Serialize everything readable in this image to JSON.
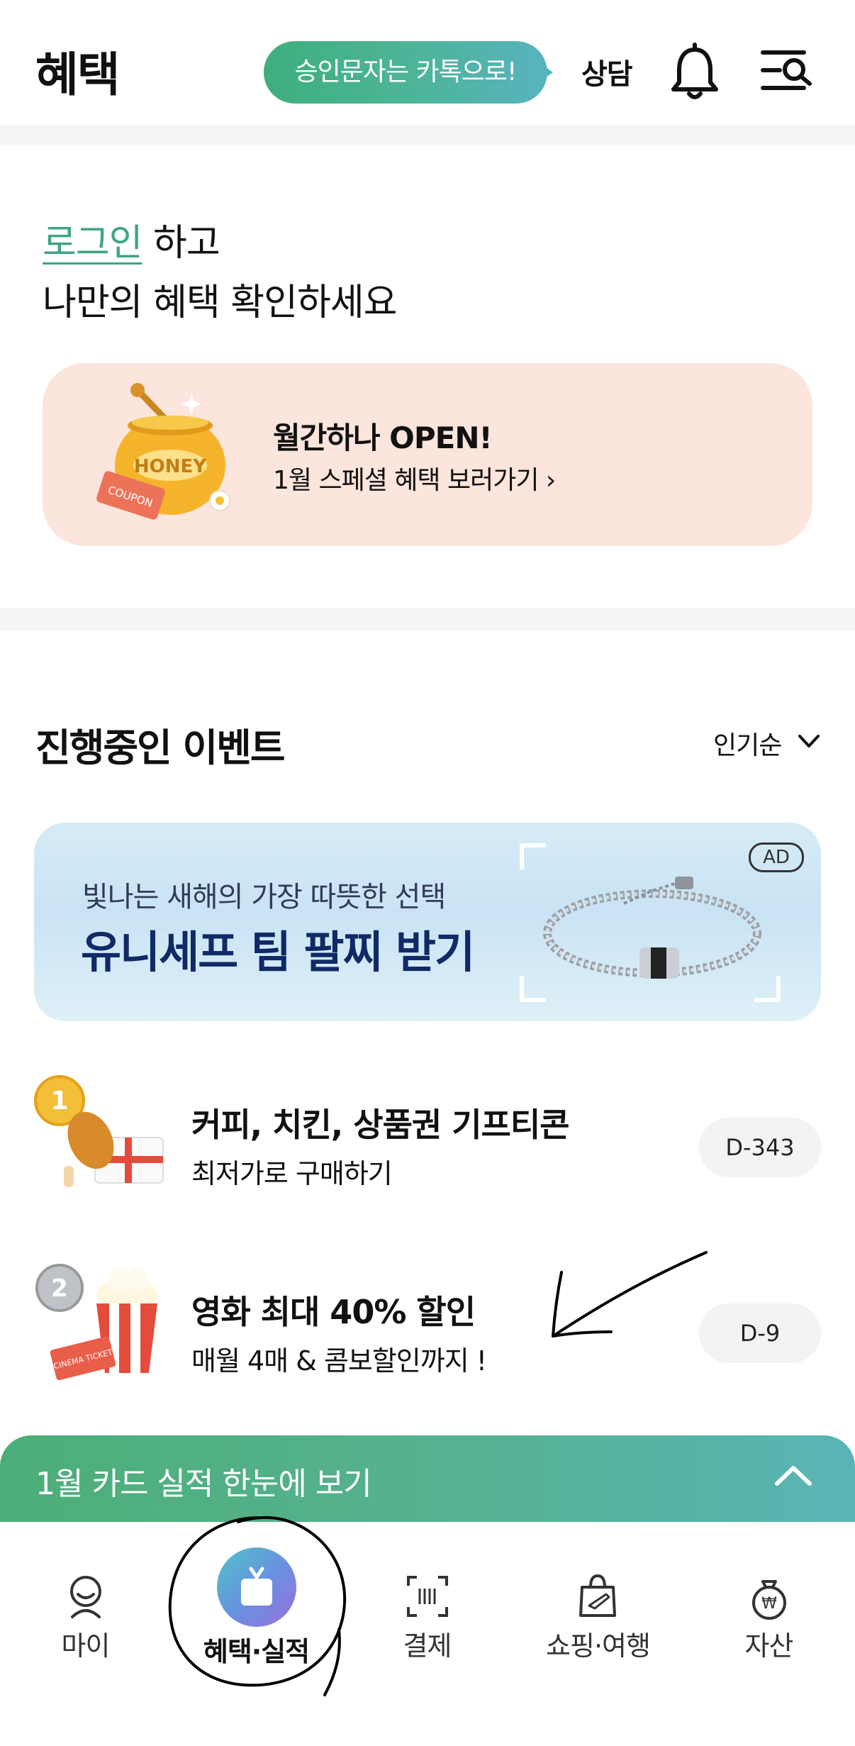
{
  "header": {
    "title": "혜택",
    "kakao_banner": "승인문자는 카톡으로!",
    "consult_label": "상담",
    "bell_icon": "bell-icon",
    "menu_icon": "menu-search-icon"
  },
  "login": {
    "link_text": "로그인",
    "line1_suffix": " 하고",
    "line2": "나만의 혜택 확인하세요"
  },
  "promo": {
    "title": "월간하나 OPEN!",
    "subtitle": "1월 스페셜 혜택 보러가기 ›",
    "art_text": "HONEY",
    "coupon_text": "COUPON",
    "background": "#fbe5dc"
  },
  "events": {
    "section_title": "진행중인 이벤트",
    "sort_label": "인기순",
    "ad_banner": {
      "subtitle": "빛나는 새해의 가장 따뜻한 선택",
      "title": "유니세프 팀 팔찌 받기",
      "badge": "AD"
    },
    "items": [
      {
        "rank": "1",
        "title": "커피, 치킨, 상품권 기프티콘",
        "subtitle": "최저가로 구매하기",
        "dday": "D-343",
        "icon": "chicken-gift-icon"
      },
      {
        "rank": "2",
        "title": "영화 최대 40% 할인",
        "subtitle": "매월 4매 & 콤보할인까지 !",
        "dday": "D-9",
        "icon": "popcorn-ticket-icon",
        "ticket_text": "CINEMA TICKET"
      }
    ]
  },
  "performance_bar": {
    "label": "1월 카드 실적 한눈에 보기"
  },
  "bottom_nav": {
    "items": [
      {
        "label": "마이",
        "icon": "person-icon"
      },
      {
        "label": "혜택·실적",
        "icon": "gift-icon",
        "active": true
      },
      {
        "label": "결제",
        "icon": "barcode-scan-icon"
      },
      {
        "label": "쇼핑·여행",
        "icon": "shopping-bag-plane-icon"
      },
      {
        "label": "자산",
        "icon": "money-bag-icon"
      }
    ]
  },
  "colors": {
    "brand_green": "#3fa57f",
    "accent_gradient_start": "#4cae78",
    "accent_gradient_end": "#5ab4b6",
    "dday_bg": "#f2f3f4"
  }
}
